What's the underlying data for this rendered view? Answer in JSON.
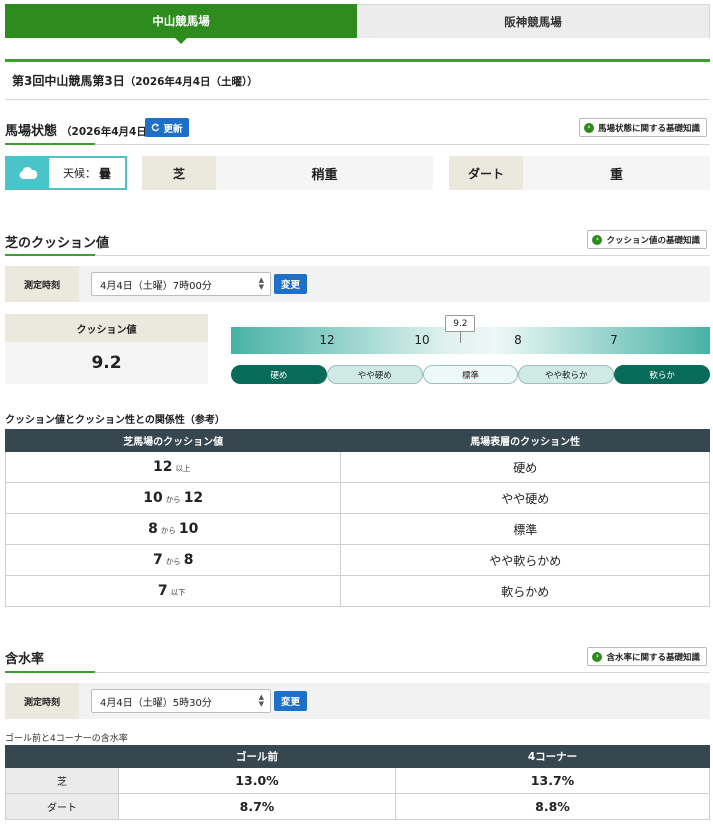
{
  "tabs": [
    {
      "label": "中山競馬場",
      "active": true
    },
    {
      "label": "阪神競馬場",
      "active": false
    }
  ],
  "race_title": "第3回中山競馬第3日",
  "race_date": "（2026年4月4日（土曜））",
  "track_condition": {
    "heading": "馬場状態",
    "date": "（2026年4月4日）",
    "refresh_label": "更新",
    "knowledge_label": "馬場状態に関する基礎知識",
    "weather_label": "天候：",
    "weather_value": "曇",
    "turf_label": "芝",
    "turf_value": "稍重",
    "dirt_label": "ダート",
    "dirt_value": "重"
  },
  "cushion": {
    "heading": "芝のクッション値",
    "knowledge_label": "クッション値の基礎知識",
    "measure_label": "測定時刻",
    "measure_value": "4月4日（土曜）7時00分",
    "change_label": "変更",
    "value_label": "クッション値",
    "value": "9.2",
    "value_num": 9.2,
    "scale_ticks": [
      "12",
      "10",
      "8",
      "7"
    ],
    "scale_levels": [
      "硬め",
      "やや硬め",
      "標準",
      "やや軟らか",
      "軟らか"
    ]
  },
  "reference": {
    "title": "クッション値とクッション性との関係性（参考）",
    "headers": [
      "芝馬場のクッション値",
      "馬場表層のクッション性"
    ],
    "rows": [
      {
        "a": "12",
        "conn": "以上",
        "b": "",
        "desc": "硬め"
      },
      {
        "a": "10",
        "conn": "から",
        "b": "12",
        "desc": "やや硬め"
      },
      {
        "a": "8",
        "conn": "から",
        "b": "10",
        "desc": "標準"
      },
      {
        "a": "7",
        "conn": "から",
        "b": "8",
        "desc": "やや軟らかめ"
      },
      {
        "a": "7",
        "conn": "以下",
        "b": "",
        "desc": "軟らかめ"
      }
    ]
  },
  "moisture": {
    "heading": "含水率",
    "knowledge_label": "含水率に関する基礎知識",
    "measure_label": "測定時刻",
    "measure_value": "4月4日（土曜）5時30分",
    "change_label": "変更",
    "table_title": "ゴール前と4コーナーの含水率",
    "headers": [
      "ゴール前",
      "4コーナー"
    ],
    "rows": [
      {
        "label": "芝",
        "goal": "13.0%",
        "corner": "13.7%"
      },
      {
        "label": "ダート",
        "goal": "8.7%",
        "corner": "8.8%"
      }
    ]
  },
  "colors": {
    "tab_active": "#2e8b1e",
    "button_blue": "#1d6fc8",
    "weather_accent": "#4bc4c9",
    "table_header": "#37474f",
    "scale_dark": "#086a59"
  },
  "icons": {
    "refresh": "refresh-icon",
    "knowledge": "chevron-circle-icon",
    "weather": "cloud-icon"
  }
}
